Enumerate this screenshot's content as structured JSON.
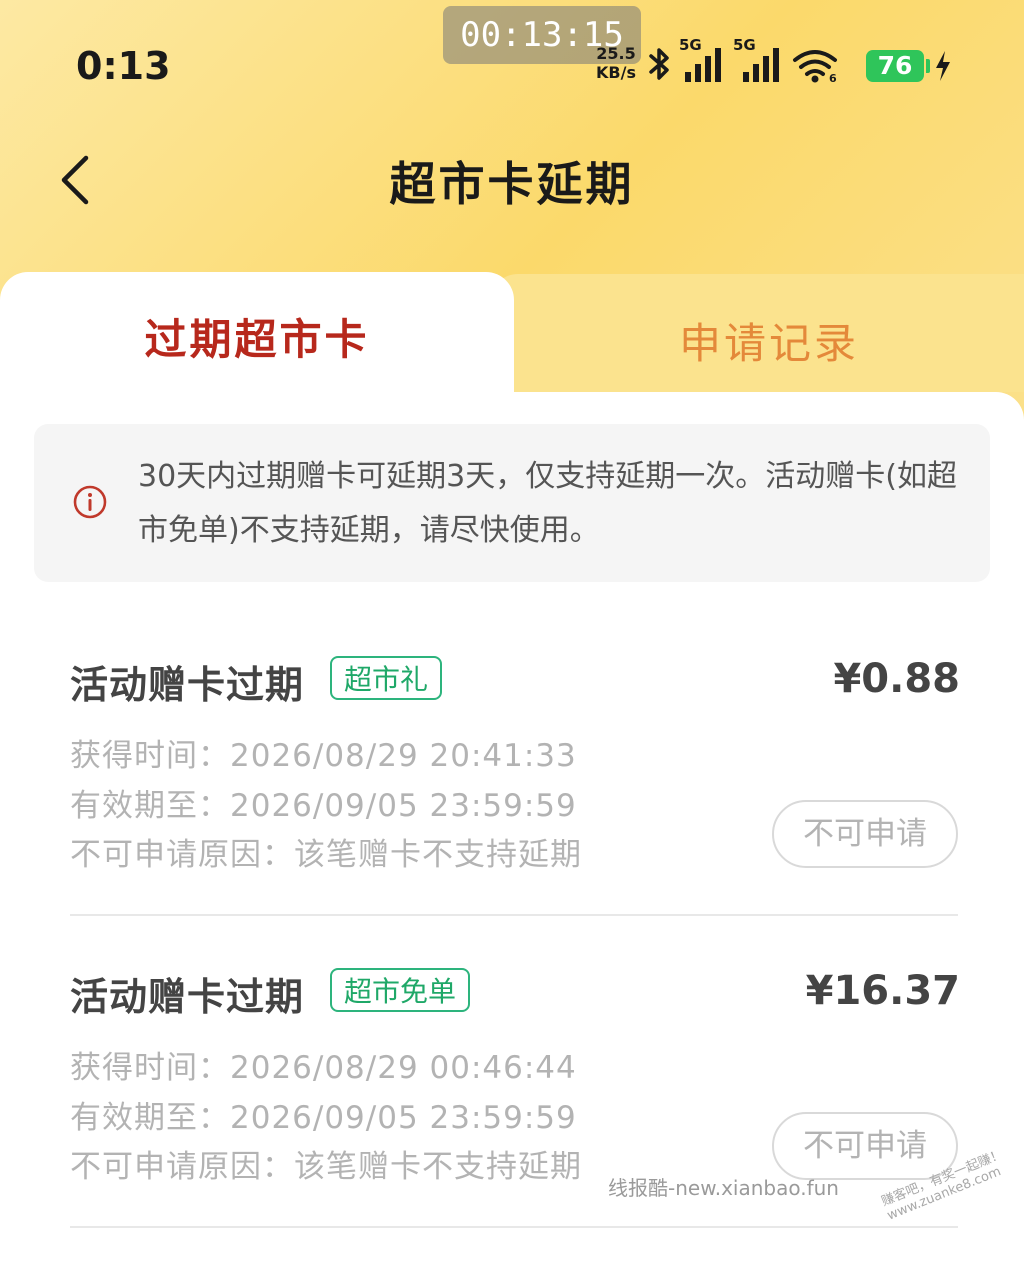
{
  "status_bar": {
    "time": "0:13",
    "recording_timer": "00:13:15",
    "net_speed_value": "25.5",
    "net_speed_unit": "KB/s",
    "signal_label_1": "5G",
    "signal_label_2": "5G",
    "battery": "76"
  },
  "header": {
    "title": "超市卡延期"
  },
  "tabs": [
    {
      "label": "过期超市卡",
      "active": true
    },
    {
      "label": "申请记录",
      "active": false
    }
  ],
  "notice": {
    "text": "30天内过期赠卡可延期3天，仅支持延期一次。活动赠卡(如超市免单)不支持延期，请尽快使用。"
  },
  "cards": [
    {
      "title": "活动赠卡过期",
      "tag": "超市礼",
      "amount": "¥0.88",
      "obtained": "获得时间：2026/08/29 20:41:33",
      "valid_until": "有效期至：2026/09/05 23:59:59",
      "reason": "不可申请原因：该笔赠卡不支持延期",
      "button": "不可申请"
    },
    {
      "title": "活动赠卡过期",
      "tag": "超市免单",
      "amount": "¥16.37",
      "obtained": "获得时间：2026/08/29 00:46:44",
      "valid_until": "有效期至：2026/09/05 23:59:59",
      "reason": "不可申请原因：该笔赠卡不支持延期",
      "button": "不可申请"
    }
  ],
  "watermarks": {
    "line1": "线报酷-new.xianbao.fun",
    "line2": "赚客吧，有奖一起赚！ www.zuanke8.com"
  },
  "colors": {
    "header_gradient": "#fbd96b",
    "active_tab_text": "#b7281c",
    "inactive_tab_text": "#e4893a",
    "tag_green": "#1fa868",
    "battery_green": "#2fc55a",
    "notice_icon_red": "#c0392b"
  }
}
